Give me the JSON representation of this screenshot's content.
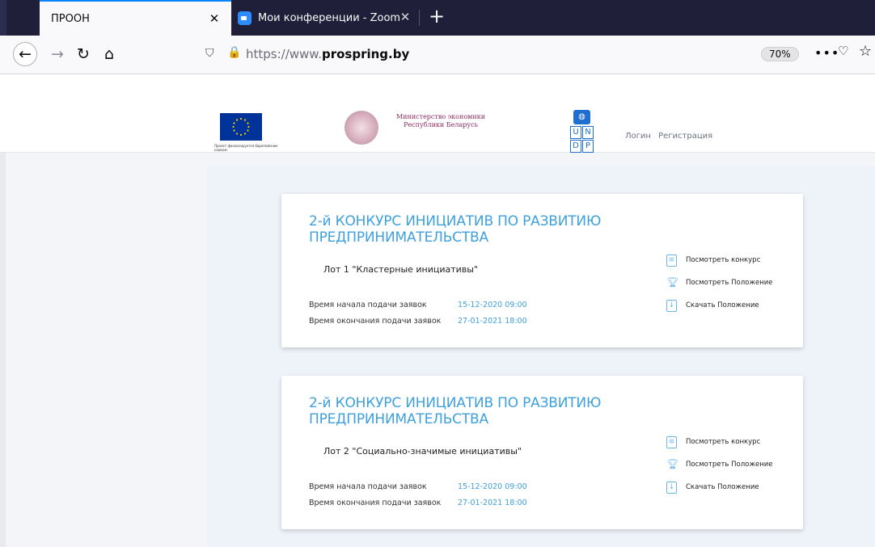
{
  "browser": {
    "tabs": [
      {
        "title": "ПРООН",
        "close": "✕"
      },
      {
        "title": "Мои конференции - Zoom",
        "close": "✕"
      }
    ],
    "new_tab": "+",
    "url_prefix": "https://www.",
    "url_domain": "prospring.by",
    "zoom": "70%",
    "more": "•••"
  },
  "header": {
    "eu_caption": "Проект финансируется Европейским союзом",
    "ministry": "Министерство экономики Республики Беларусь",
    "undp_letters": [
      "U",
      "N",
      "D",
      "P"
    ],
    "login": "Логин",
    "register": "Регистрация"
  },
  "cards": [
    {
      "title": "2-й КОНКУРС ИНИЦИАТИВ ПО РАЗВИТИЮ ПРЕДПРИНИМАТЕЛЬСТВА",
      "lot": "Лот 1 \"Кластерные инициативы\"",
      "start_label": "Время начала подачи заявок",
      "start_value": "15-12-2020 09:00",
      "end_label": "Время окончания подачи заявок",
      "end_value": "27-01-2021 18:00",
      "links": [
        "Посмотреть конкурс",
        "Посмотреть Положение",
        "Скачать Положение"
      ]
    },
    {
      "title": "2-й КОНКУРС ИНИЦИАТИВ ПО РАЗВИТИЮ ПРЕДПРИНИМАТЕЛЬСТВА",
      "lot": "Лот 2 \"Социально-значимые инициативы\"",
      "start_label": "Время начала подачи заявок",
      "start_value": "15-12-2020 09:00",
      "end_label": "Время окончания подачи заявок",
      "end_value": "27-01-2021 18:00",
      "links": [
        "Посмотреть конкурс",
        "Посмотреть Положение",
        "Скачать Положение"
      ]
    }
  ],
  "colors": {
    "accent": "#3ea0dc",
    "tabbar": "#1f1f3a",
    "page_bg": "#eef3f9"
  }
}
